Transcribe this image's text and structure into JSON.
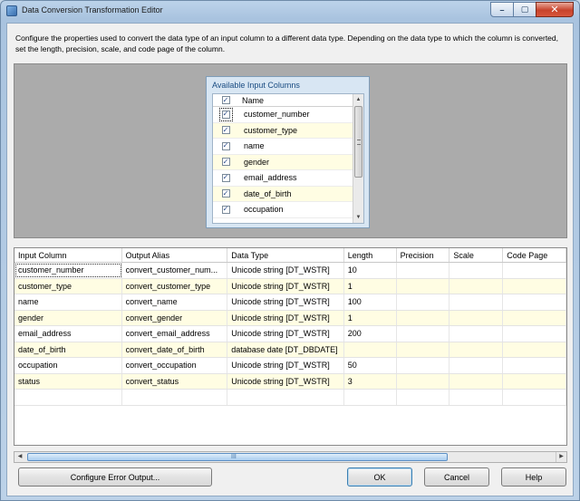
{
  "window": {
    "title": "Data Conversion Transformation Editor",
    "controls": {
      "minimize": "–",
      "maximize": "▢",
      "close": "✕"
    }
  },
  "description": "Configure the properties used to convert the data type of an input column to a different data type. Depending on the data type to which the column is converted, set the length, precision, scale, and code page of the column.",
  "available_columns": {
    "title": "Available Input Columns",
    "header": "Name",
    "items": [
      {
        "label": "customer_number",
        "checked": true
      },
      {
        "label": "customer_type",
        "checked": true
      },
      {
        "label": "name",
        "checked": true
      },
      {
        "label": "gender",
        "checked": true
      },
      {
        "label": "email_address",
        "checked": true
      },
      {
        "label": "date_of_birth",
        "checked": true
      },
      {
        "label": "occupation",
        "checked": true
      }
    ]
  },
  "grid": {
    "headers": [
      "Input Column",
      "Output Alias",
      "Data Type",
      "Length",
      "Precision",
      "Scale",
      "Code Page"
    ],
    "rows": [
      [
        "customer_number",
        "convert_customer_num...",
        "Unicode string [DT_WSTR]",
        "10",
        "",
        "",
        ""
      ],
      [
        "customer_type",
        "convert_customer_type",
        "Unicode string [DT_WSTR]",
        "1",
        "",
        "",
        ""
      ],
      [
        "name",
        "convert_name",
        "Unicode string [DT_WSTR]",
        "100",
        "",
        "",
        ""
      ],
      [
        "gender",
        "convert_gender",
        "Unicode string [DT_WSTR]",
        "1",
        "",
        "",
        ""
      ],
      [
        "email_address",
        "convert_email_address",
        "Unicode string [DT_WSTR]",
        "200",
        "",
        "",
        ""
      ],
      [
        "date_of_birth",
        "convert_date_of_birth",
        "database date [DT_DBDATE]",
        "",
        "",
        "",
        ""
      ],
      [
        "occupation",
        "convert_occupation",
        "Unicode string [DT_WSTR]",
        "50",
        "",
        "",
        ""
      ],
      [
        "status",
        "convert_status",
        "Unicode string [DT_WSTR]",
        "3",
        "",
        "",
        ""
      ]
    ]
  },
  "buttons": {
    "configure_error": "Configure Error Output...",
    "ok": "OK",
    "cancel": "Cancel",
    "help": "Help"
  },
  "scroll": {
    "grip": "III"
  }
}
